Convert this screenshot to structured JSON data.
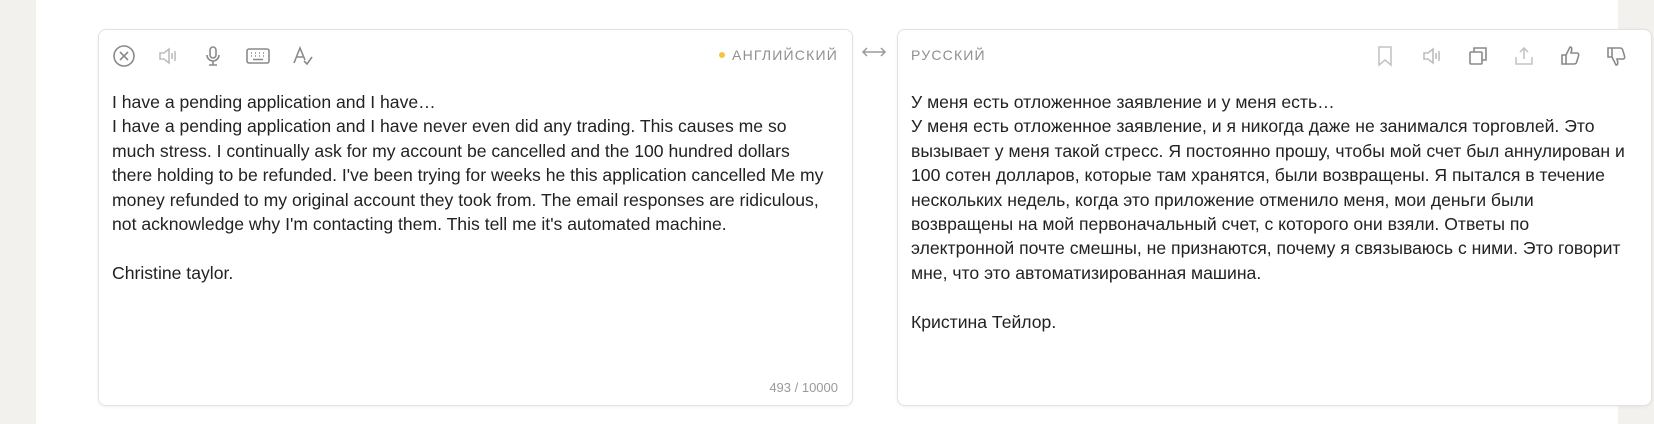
{
  "source": {
    "language": "АНГЛИЙСКИЙ",
    "text": "I have a pending application and I have…\nI have a pending application and I have never even did any trading. This causes me so much stress. I continually ask for my account be cancelled and the 100 hundred dollars there holding to be refunded. I've been trying for weeks he this application cancelled Me my money refunded to my original account they took from. The email responses are ridiculous, not acknowledge why I'm contacting them. This tell me it's automated machine.\n\nChristine taylor.",
    "counter": "493 / 10000",
    "icons": [
      "clear-icon",
      "speaker-icon",
      "microphone-icon",
      "keyboard-icon",
      "spellcheck-icon"
    ]
  },
  "swap_icon": "swap-arrows-icon",
  "target": {
    "language": "РУССКИЙ",
    "text": "У меня есть отложенное заявление и у меня есть…\nУ меня есть отложенное заявление, и я никогда даже не занимался торговлей. Это вызывает у меня такой стресс. Я постоянно прошу, чтобы мой счет был аннулирован и 100 сотен долларов, которые там хранятся, были возвращены. Я пытался в течение нескольких недель, когда это приложение отменило меня, мои деньги были возвращены на мой первоначальный счет, с которого они взяли. Ответы по электронной почте смешны, не признаются, почему я связываюсь с ними. Это говорит мне, что это автоматизированная машина.\n\nКристина Тейлор.",
    "icons": [
      "bookmark-icon",
      "speaker-icon",
      "copy-icon",
      "share-icon",
      "thumbs-up-icon",
      "thumbs-down-icon"
    ]
  },
  "colors": {
    "background": "#f3f1ed",
    "panel": "#ffffff",
    "icon": "#8a8a8a",
    "text": "#222222",
    "accent_dot": "#f6c343"
  }
}
